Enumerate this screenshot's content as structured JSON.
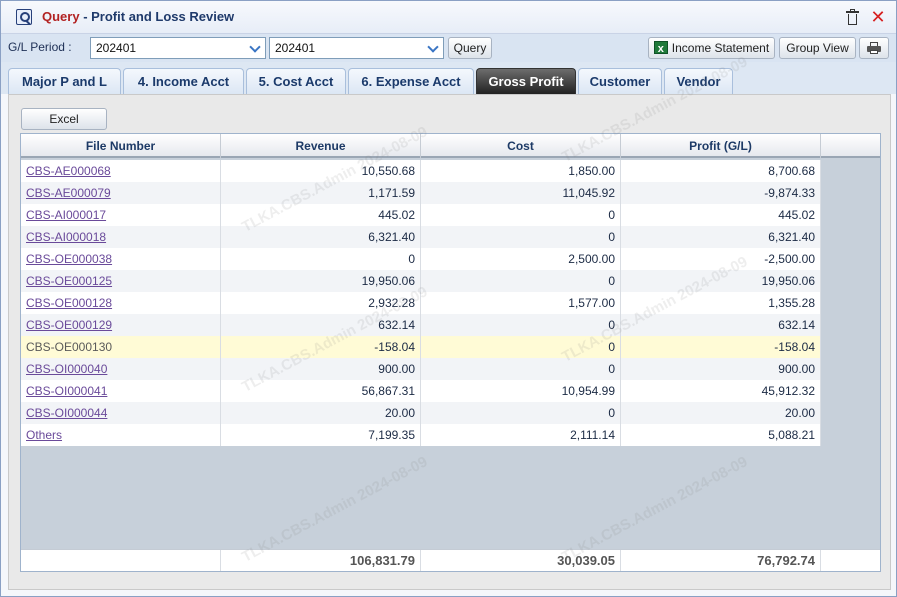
{
  "title": {
    "prefix": "Query",
    "dash": " - ",
    "text": "Profit and Loss Review"
  },
  "toolbar": {
    "gl_period_label": "G/L Period :",
    "period_from": "202401",
    "period_to": "202401",
    "query_label": "Query",
    "income_statement_label": "Income Statement",
    "group_view_label": "Group View"
  },
  "tabs": [
    {
      "label": "Major P and L",
      "active": false
    },
    {
      "label": "4. Income Acct",
      "active": false
    },
    {
      "label": "5. Cost Acct",
      "active": false
    },
    {
      "label": "6. Expense Acct",
      "active": false
    },
    {
      "label": "Gross Profit",
      "active": true
    },
    {
      "label": "Customer",
      "active": false
    },
    {
      "label": "Vendor",
      "active": false
    }
  ],
  "panel": {
    "excel_label": "Excel"
  },
  "table": {
    "columns": [
      "File Number",
      "Revenue",
      "Cost",
      "Profit (G/L)"
    ],
    "rows": [
      {
        "file": "CBS-AE000068",
        "revenue": "10,550.68",
        "cost": "1,850.00",
        "profit": "8,700.68"
      },
      {
        "file": "CBS-AE000079",
        "revenue": "1,171.59",
        "cost": "11,045.92",
        "profit": "-9,874.33"
      },
      {
        "file": "CBS-AI000017",
        "revenue": "445.02",
        "cost": "0",
        "profit": "445.02"
      },
      {
        "file": "CBS-AI000018",
        "revenue": "6,321.40",
        "cost": "0",
        "profit": "6,321.40"
      },
      {
        "file": "CBS-OE000038",
        "revenue": "0",
        "cost": "2,500.00",
        "profit": "-2,500.00"
      },
      {
        "file": "CBS-OE000125",
        "revenue": "19,950.06",
        "cost": "0",
        "profit": "19,950.06"
      },
      {
        "file": "CBS-OE000128",
        "revenue": "2,932.28",
        "cost": "1,577.00",
        "profit": "1,355.28"
      },
      {
        "file": "CBS-OE000129",
        "revenue": "632.14",
        "cost": "0",
        "profit": "632.14"
      },
      {
        "file": "CBS-OE000130",
        "revenue": "-158.04",
        "cost": "0",
        "profit": "-158.04"
      },
      {
        "file": "CBS-OI000040",
        "revenue": "900.00",
        "cost": "0",
        "profit": "900.00"
      },
      {
        "file": "CBS-OI000041",
        "revenue": "56,867.31",
        "cost": "10,954.99",
        "profit": "45,912.32"
      },
      {
        "file": "CBS-OI000044",
        "revenue": "20.00",
        "cost": "0",
        "profit": "20.00"
      },
      {
        "file": "Others",
        "revenue": "7,199.35",
        "cost": "2,111.14",
        "profit": "5,088.21"
      }
    ],
    "totals": {
      "revenue": "106,831.79",
      "cost": "30,039.05",
      "profit": "76,792.74"
    }
  },
  "watermark_text": "TLKA.CBS.Admin 2024-08-09",
  "colors": {
    "title_prefix": "#b22222",
    "active_tab": "#1e1e1e",
    "highlight_row": "#fffbd6",
    "link": "#6a4a9a"
  }
}
